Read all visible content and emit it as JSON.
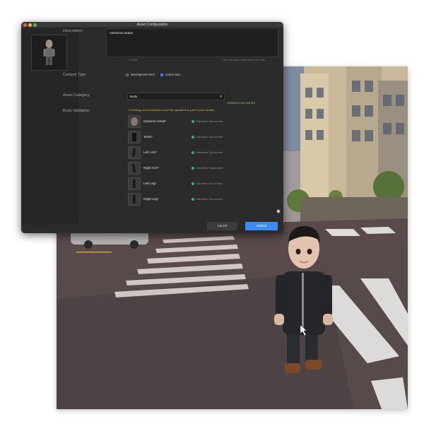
{
  "window": {
    "title": "Asset Configuration"
  },
  "form": {
    "description_label": "Description",
    "description_value": "Awesome avatar",
    "char_count": "14/1000",
    "add_link_hint": "Add any https://www.roblox.com links",
    "content_type_label": "Content Type",
    "content_type_options": [
      "Development Item",
      "Avatar Item"
    ],
    "content_type_selected": "Avatar Item",
    "asset_category_label": "Asset Category",
    "asset_category_value": "Body",
    "asset_category_status": "Validation Succeeded",
    "body_validation_label": "Body Validation",
    "warning": "Clothing and Accessories won't be uploaded as part of your bundle.",
    "body_parts": [
      {
        "name": "Dynamic Head*",
        "status": "Validation Succeeded"
      },
      {
        "name": "Torso*",
        "status": "Validation Succeeded"
      },
      {
        "name": "Left Arm*",
        "status": "Validation Succeeded"
      },
      {
        "name": "Right Arm*",
        "status": "Validation Succeeded"
      },
      {
        "name": "Left Leg*",
        "status": "Validation Succeeded"
      },
      {
        "name": "Right Leg*",
        "status": "Validation Succeeded"
      }
    ]
  },
  "footer": {
    "cancel_label": "Cancel",
    "submit_label": "Submit"
  },
  "icons": {
    "warning": "warning-icon",
    "check": "check-circle-icon",
    "chevron": "chevron-down-icon"
  },
  "colors": {
    "dialog_bg": "#2b2b2b",
    "accent": "#3d8cf0",
    "success": "#4cc770",
    "warning": "#e3b341"
  }
}
